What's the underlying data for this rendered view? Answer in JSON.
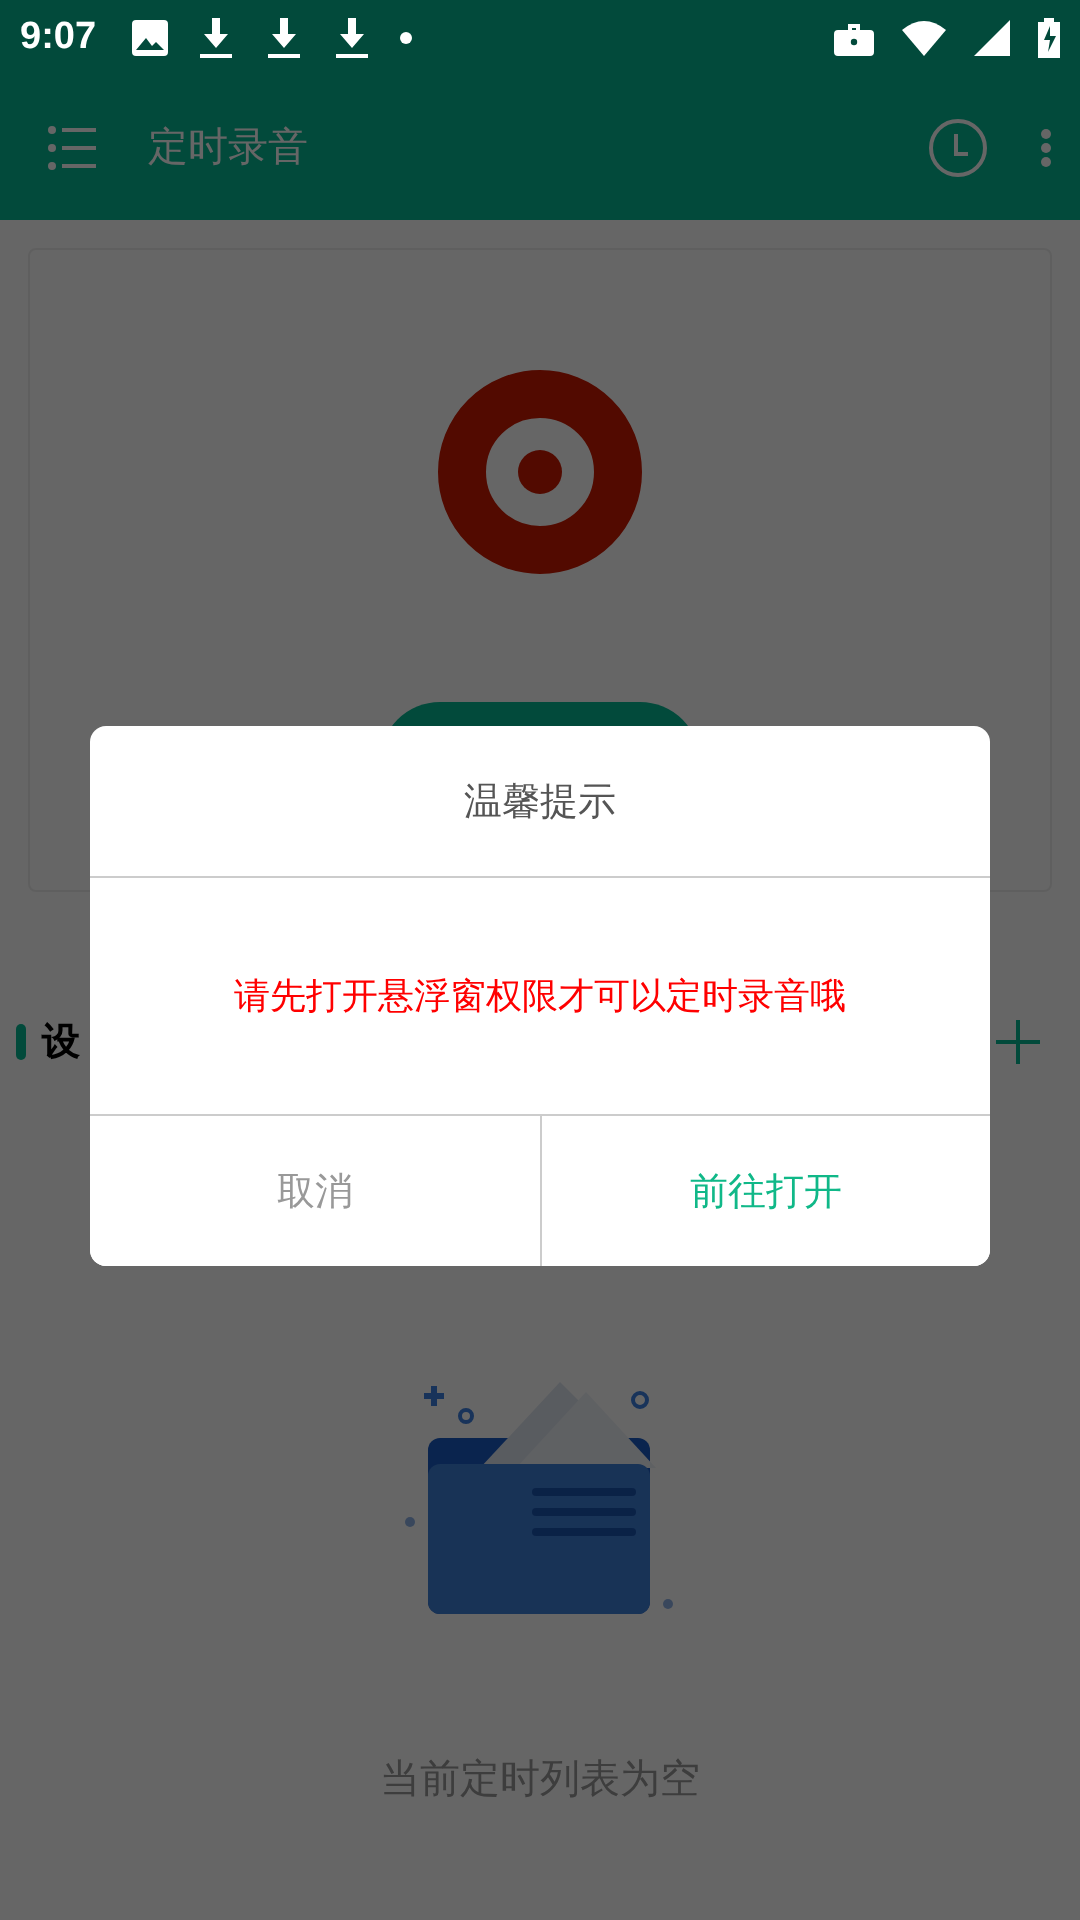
{
  "status_bar": {
    "time": "9:07"
  },
  "toolbar": {
    "title": "定时录音"
  },
  "section": {
    "title": "设"
  },
  "empty_state": {
    "text": "当前定时列表为空"
  },
  "dialog": {
    "title": "温馨提示",
    "message": "请先打开悬浮窗权限才可以定时录音哦",
    "buttons": [
      {
        "label": "取消",
        "kind": "cancel"
      },
      {
        "label": "前往打开",
        "kind": "confirm"
      }
    ]
  }
}
